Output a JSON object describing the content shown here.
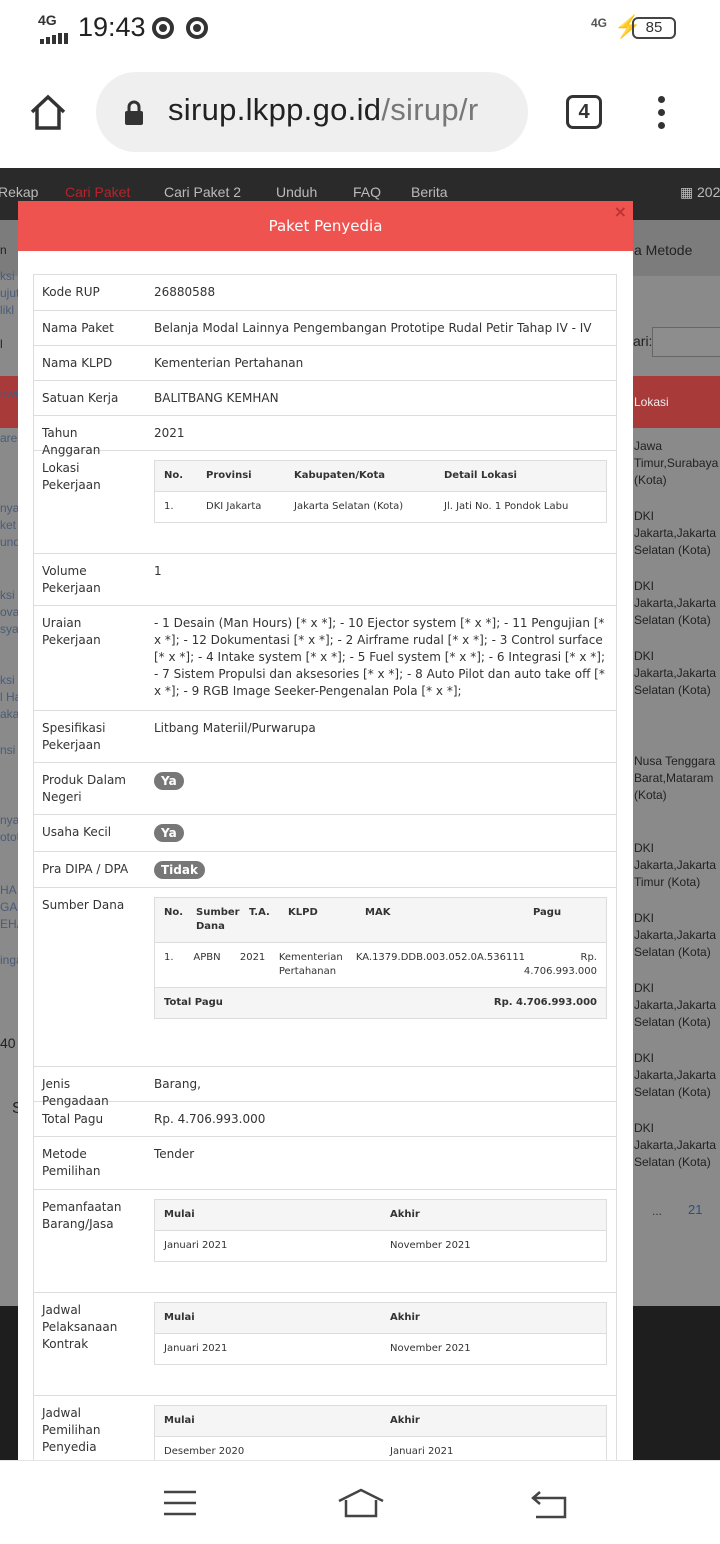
{
  "status": {
    "network": "4G",
    "time": "19:43",
    "network_right": "4G",
    "battery": "85"
  },
  "browser": {
    "url_host": "sirup.lkpp.go.id",
    "url_path": "/sirup/r",
    "tab_count": "4"
  },
  "nav": {
    "items": [
      "Rekap",
      "Cari Paket",
      "Cari Paket 2",
      "Unduh",
      "FAQ",
      "Berita"
    ],
    "date_prefix": "202"
  },
  "background": {
    "metode": "a Metode",
    "cari": "ari:",
    "lokasi": "Lokasi",
    "left_fragments": [
      "ksi",
      "ujut",
      "likl",
      "dwit",
      "are",
      "nya",
      "ket",
      "und",
      "ksi",
      "ova",
      "sya",
      "ksi P",
      "l Ha",
      "aka",
      "nsi",
      "nya",
      "otot",
      "HA",
      "GAS",
      "EHA",
      "inga",
      "40",
      "S",
      "L"
    ],
    "right_locations": [
      "Jawa Timur,Surabaya (Kota)",
      "DKI Jakarta,Jakarta Selatan (Kota)",
      "DKI Jakarta,Jakarta Selatan (Kota)",
      "DKI Jakarta,Jakarta Selatan (Kota)",
      "Nusa Tenggara Barat,Mataram (Kota)",
      "DKI Jakarta,Jakarta Timur (Kota)",
      "DKI Jakarta,Jakarta Selatan (Kota)",
      "DKI Jakarta,Jakarta Selatan (Kota)",
      "DKI Jakarta,Jakarta Selatan (Kota)",
      "DKI Jakarta,Jakarta Selatan (Kota)"
    ],
    "pager": [
      "...",
      "21"
    ]
  },
  "modal": {
    "title": "Paket Penyedia",
    "close": "×",
    "kode_rup": {
      "label": "Kode RUP",
      "value": "26880588"
    },
    "nama_paket": {
      "label": "Nama Paket",
      "value": "Belanja Modal Lainnya Pengembangan Prototipe Rudal Petir Tahap IV - IV"
    },
    "nama_klpd": {
      "label": "Nama KLPD",
      "value": "Kementerian Pertahanan"
    },
    "satuan_kerja": {
      "label": "Satuan Kerja",
      "value": "BALITBANG KEMHAN"
    },
    "tahun_anggaran": {
      "label": "Tahun Anggaran",
      "value": "2021"
    },
    "lokasi": {
      "label": "Lokasi Pekerjaan",
      "headers": [
        "No.",
        "Provinsi",
        "Kabupaten/Kota",
        "Detail Lokasi"
      ],
      "row": [
        "1.",
        "DKI Jakarta",
        "Jakarta Selatan (Kota)",
        "Jl. Jati No. 1 Pondok Labu"
      ]
    },
    "volume": {
      "label": "Volume Pekerjaan",
      "value": "1"
    },
    "uraian": {
      "label": "Uraian Pekerjaan",
      "value": "- 1 Desain (Man Hours) [* x *]; - 10 Ejector system [* x *]; - 11 Pengujian [* x *]; - 12 Dokumentasi [* x *]; - 2 Airframe rudal [* x *]; - 3 Control surface [* x *]; - 4 Intake system [* x *]; - 5 Fuel system [* x *]; - 6 Integrasi [* x *]; - 7 Sistem Propulsi dan aksesories [* x *]; - 8 Auto Pilot dan auto take off [* x *]; - 9 RGB Image Seeker-Pengenalan Pola [* x *];"
    },
    "spesifikasi": {
      "label": "Spesifikasi Pekerjaan",
      "value": "Litbang Materiil/Purwarupa"
    },
    "produk": {
      "label": "Produk Dalam Negeri",
      "value": "Ya"
    },
    "usaha": {
      "label": "Usaha Kecil",
      "value": "Ya"
    },
    "pradipa": {
      "label": "Pra DIPA / DPA",
      "value": "Tidak"
    },
    "sumber": {
      "label": "Sumber Dana",
      "headers": [
        "No.",
        "Sumber Dana",
        "T.A.",
        "KLPD",
        "MAK",
        "Pagu"
      ],
      "row": [
        "1.",
        "APBN",
        "2021",
        "Kementerian Pertahanan",
        "KA.1379.DDB.003.052.0A.536111",
        "Rp. 4.706.993.000"
      ],
      "total_label": "Total Pagu",
      "total_value": "Rp. 4.706.993.000"
    },
    "jenis": {
      "label": "Jenis Pengadaan",
      "value": "Barang,"
    },
    "total_pagu": {
      "label": "Total Pagu",
      "value": "Rp. 4.706.993.000"
    },
    "metode": {
      "label": "Metode Pemilihan",
      "value": "Tender"
    },
    "pemanfaatan": {
      "label": "Pemanfaatan Barang/Jasa",
      "headers": [
        "Mulai",
        "Akhir"
      ],
      "row": [
        "Januari 2021",
        "November 2021"
      ]
    },
    "pelaksanaan": {
      "label": "Jadwal Pelaksanaan Kontrak",
      "headers": [
        "Mulai",
        "Akhir"
      ],
      "row": [
        "Januari 2021",
        "November 2021"
      ]
    },
    "pemilihan": {
      "label": "Jadwal Pemilihan Penyedia",
      "headers": [
        "Mulai",
        "Akhir"
      ],
      "row": [
        "Desember 2020",
        "Januari 2021"
      ]
    }
  }
}
